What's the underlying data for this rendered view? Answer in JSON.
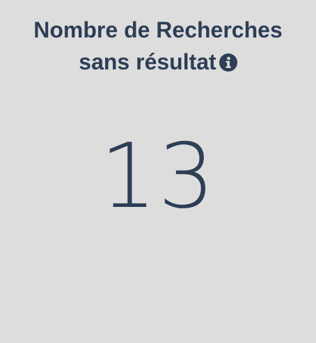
{
  "widget": {
    "title_line1": "Nombre de Recherches",
    "title_line2": "sans résultat",
    "info_icon": "info-circle-icon",
    "value": "13"
  },
  "colors": {
    "background": "#dddddd",
    "text": "#2d3e56"
  }
}
